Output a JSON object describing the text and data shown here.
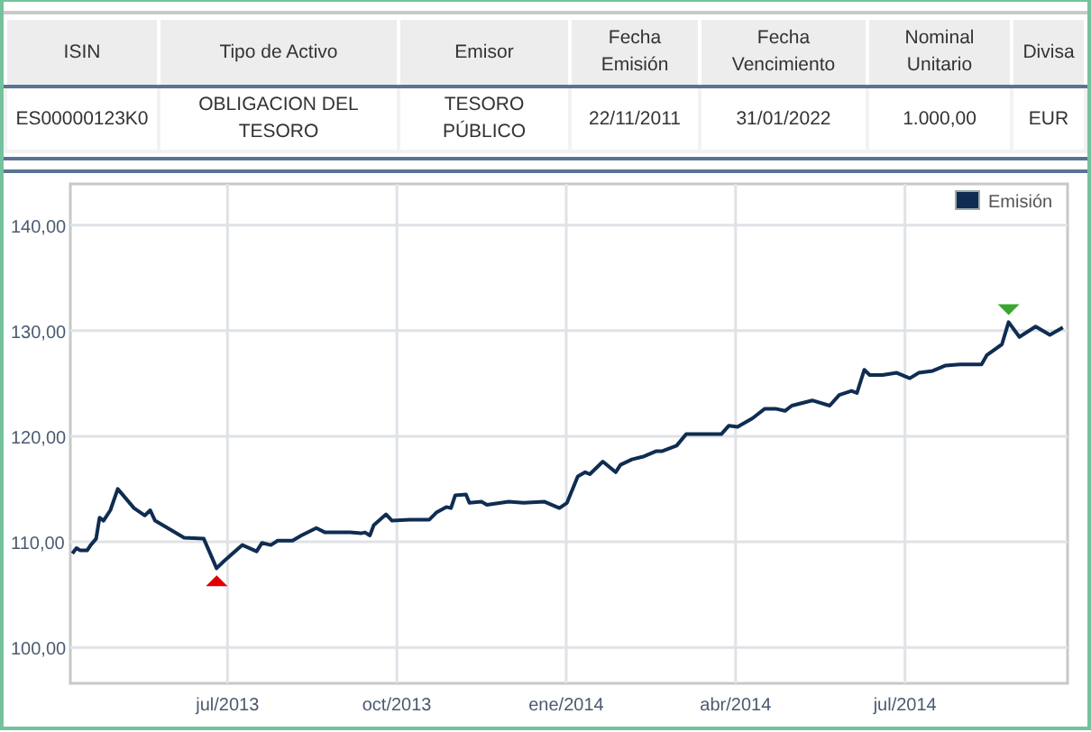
{
  "table": {
    "columns": [
      "ISIN",
      "Tipo de Activo",
      "Emisor",
      "Fecha Emisión",
      "Fecha Vencimiento",
      "Nominal Unitario",
      "Divisa"
    ],
    "rows": [
      [
        "ES00000123K0",
        "OBLIGACION DEL TESORO",
        "TESORO PÚBLICO",
        "22/11/2011",
        "31/01/2022",
        "1.000,00",
        "EUR"
      ]
    ]
  },
  "chart": {
    "markers": [
      {
        "kind": "min",
        "color": "#e00000"
      },
      {
        "kind": "max",
        "color": "#3aa62e"
      }
    ],
    "chart_data": {
      "type": "line",
      "grid": true,
      "xlim": [
        2013.268,
        2014.74
      ],
      "ylim": [
        96.6,
        143.9
      ],
      "xticks": [
        {
          "value": 2013.5,
          "label": "jul/2013"
        },
        {
          "value": 2013.75,
          "label": "oct/2013"
        },
        {
          "value": 2014,
          "label": "ene/2014"
        },
        {
          "value": 2014.25,
          "label": "abr/2014"
        },
        {
          "value": 2014.5,
          "label": "jul/2014"
        }
      ],
      "yticks": [
        {
          "value": 100,
          "label": "100,00"
        },
        {
          "value": 110,
          "label": "110,00"
        },
        {
          "value": 120,
          "label": "120,00"
        },
        {
          "value": 130,
          "label": "130,00"
        },
        {
          "value": 140,
          "label": "140,00"
        }
      ],
      "x": [
        2013.271,
        2013.277,
        2013.282,
        2013.293,
        2013.298,
        2013.306,
        2013.311,
        2013.317,
        2013.327,
        2013.338,
        2013.362,
        2013.378,
        2013.386,
        2013.393,
        2013.436,
        2013.465,
        2013.484,
        2013.495,
        2013.522,
        2013.543,
        2013.551,
        2013.564,
        2013.574,
        2013.596,
        2013.609,
        2013.631,
        2013.644,
        2013.681,
        2013.697,
        2013.703,
        2013.71,
        2013.716,
        2013.734,
        2013.743,
        2013.769,
        2013.798,
        2013.809,
        2013.823,
        2013.83,
        2013.836,
        2013.852,
        2013.857,
        2013.875,
        2013.883,
        2013.915,
        2013.937,
        2013.968,
        2013.99,
        2014.001,
        2014.017,
        2014.028,
        2014.035,
        2014.054,
        2014.073,
        2014.08,
        2014.097,
        2014.115,
        2014.133,
        2014.142,
        2014.163,
        2014.177,
        2014.195,
        2014.229,
        2014.24,
        2014.253,
        2014.275,
        2014.293,
        2014.309,
        2014.323,
        2014.333,
        2014.363,
        2014.389,
        2014.403,
        2014.421,
        2014.429,
        2014.44,
        2014.448,
        2014.467,
        2014.488,
        2014.507,
        2014.52,
        2014.541,
        2014.56,
        2014.581,
        2014.613,
        2014.621,
        2014.643,
        2014.653,
        2014.669,
        2014.693,
        2014.714,
        2014.733
      ],
      "series": [
        {
          "name": "Emisión",
          "color": "#0f2d52",
          "values": [
            108.9,
            109.4,
            109.2,
            109.2,
            109.7,
            110.3,
            112.3,
            112.0,
            113.0,
            115.0,
            113.2,
            112.5,
            113.0,
            112.0,
            110.4,
            110.3,
            107.5,
            108.2,
            109.7,
            109.1,
            109.9,
            109.7,
            110.1,
            110.1,
            110.6,
            111.3,
            110.9,
            110.9,
            110.8,
            110.9,
            110.6,
            111.6,
            112.6,
            112.0,
            112.1,
            112.1,
            112.8,
            113.3,
            113.2,
            114.4,
            114.5,
            113.7,
            113.8,
            113.5,
            113.8,
            113.7,
            113.8,
            113.2,
            113.7,
            116.2,
            116.6,
            116.4,
            117.6,
            116.6,
            117.3,
            117.8,
            118.1,
            118.6,
            118.6,
            119.1,
            120.2,
            120.2,
            120.2,
            121.0,
            120.9,
            121.7,
            122.6,
            122.6,
            122.4,
            122.9,
            123.4,
            122.9,
            123.9,
            124.3,
            124.1,
            126.3,
            125.8,
            125.8,
            126.0,
            125.5,
            126.0,
            126.2,
            126.7,
            126.8,
            126.8,
            127.7,
            128.7,
            130.8,
            129.4,
            130.4,
            129.6,
            130.3
          ]
        }
      ]
    }
  }
}
